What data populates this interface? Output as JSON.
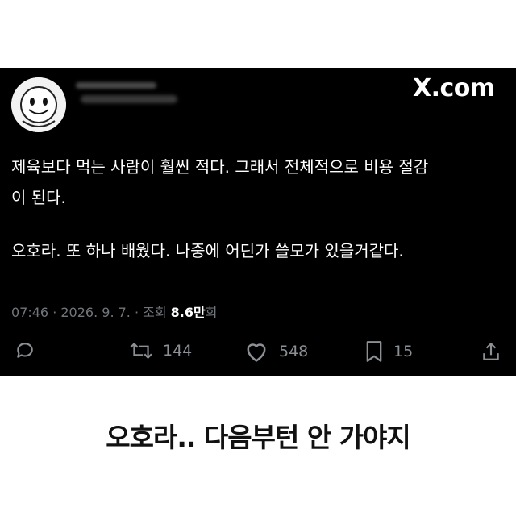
{
  "post": {
    "brand": "X.com",
    "lines": [
      "제육보다 먹는 사람이 훨씬 적다. 그래서 전체적으로 비용 절감\n이 된다.",
      "오호라. 또 하나 배웠다. 나중에 어딘가 쓸모가 있을거같다."
    ],
    "meta_prefix": "07:46 · 2026. 9. 7. · 조회 ",
    "views": "8.6만",
    "views_suffix": "회"
  },
  "actions": {
    "retweets": "144",
    "likes": "548",
    "bookmarks": "15"
  },
  "caption": "오호라.. 다음부턴 안 가야지",
  "colors": {
    "card_bg": "#000000",
    "muted": "#71767b",
    "text": "#ffffff"
  }
}
